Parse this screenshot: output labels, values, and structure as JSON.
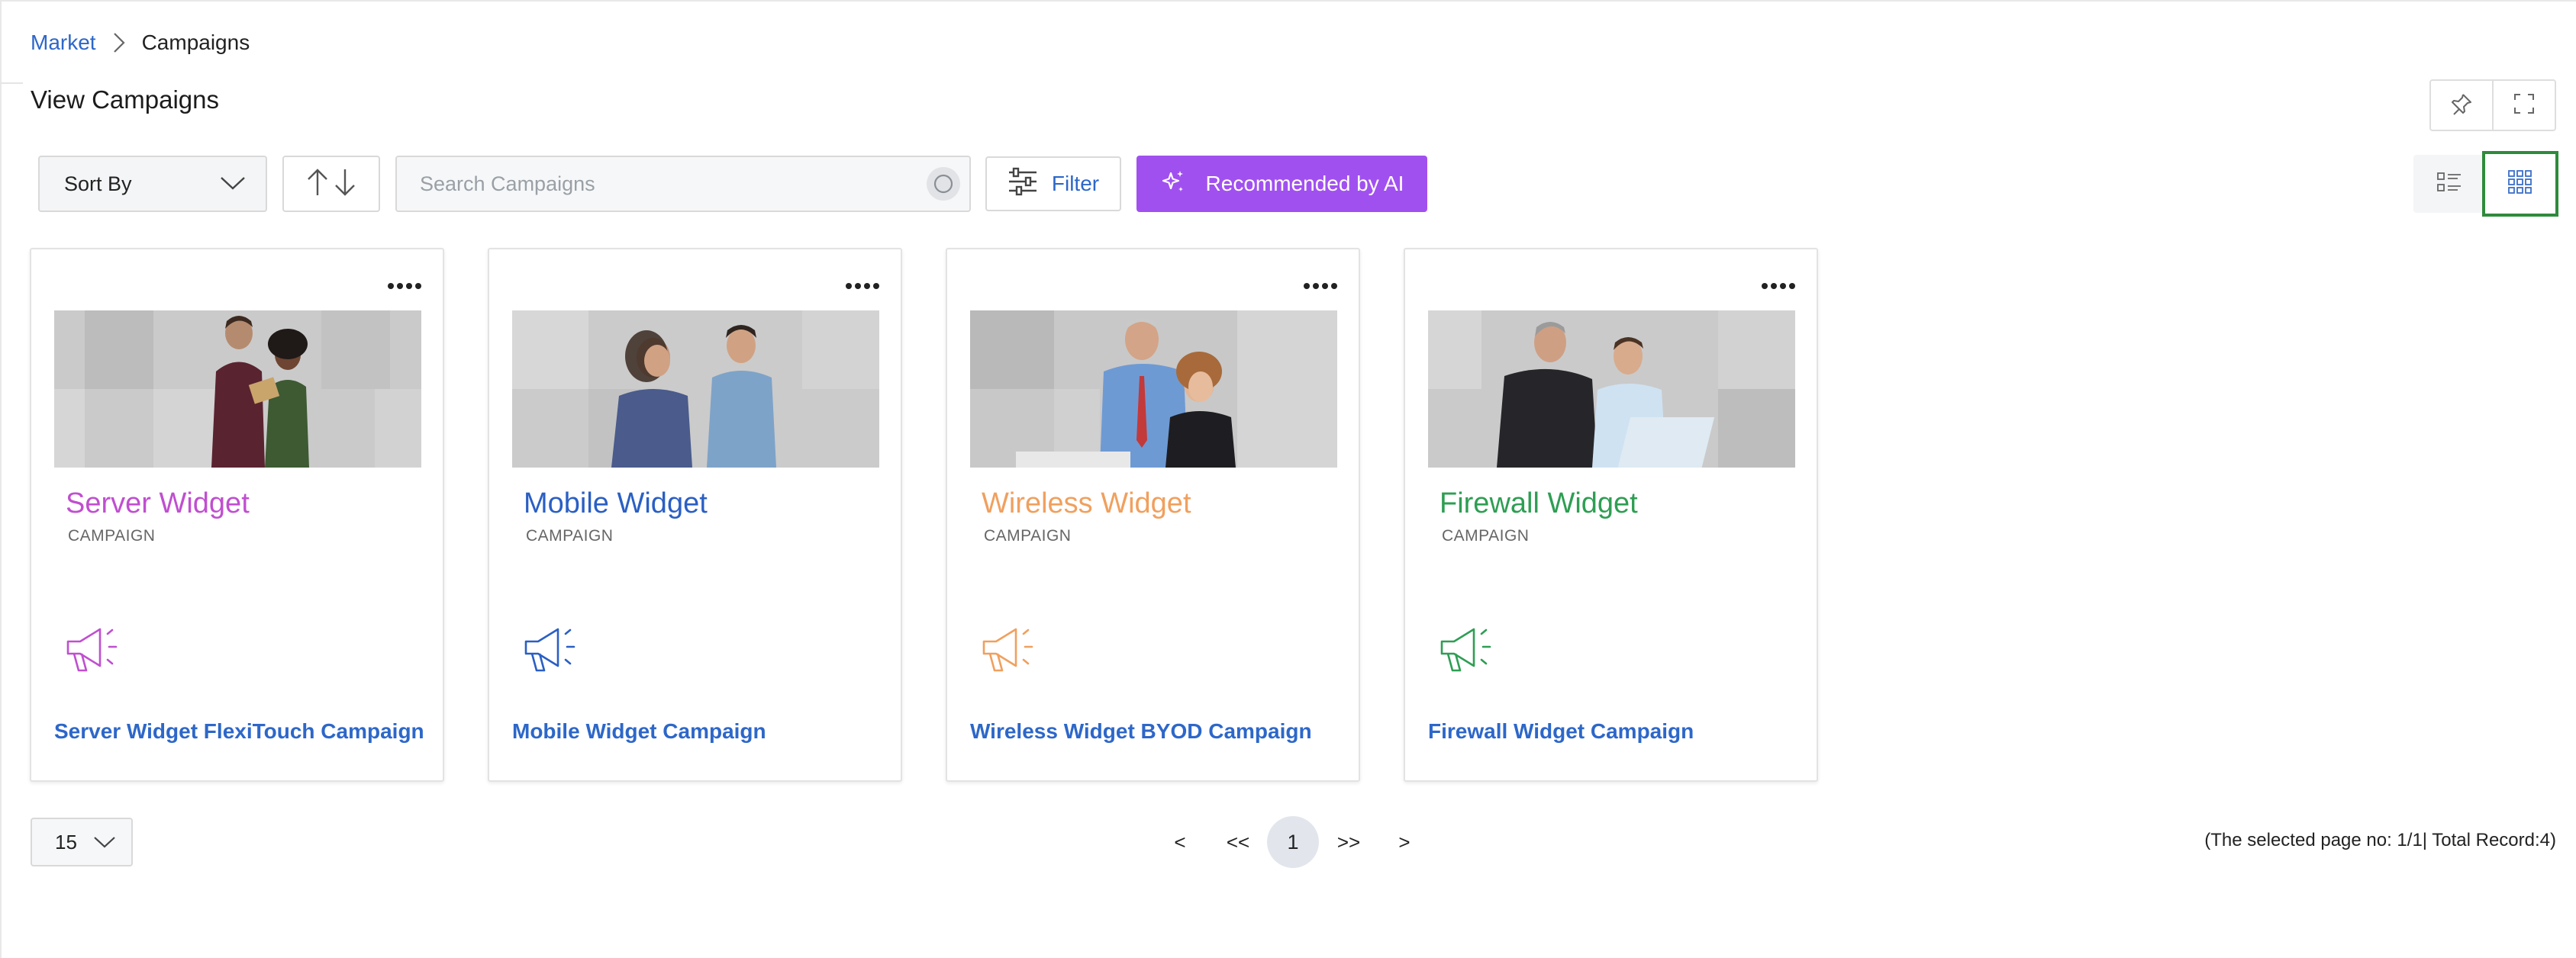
{
  "breadcrumb": {
    "parent": "Market",
    "current": "Campaigns"
  },
  "page": {
    "title": "View Campaigns"
  },
  "toolbar": {
    "sort_label": "Sort By",
    "search_placeholder": "Search Campaigns",
    "search_value": "",
    "filter_label": "Filter",
    "ai_label": "Recommended by AI"
  },
  "colors": {
    "link": "#2d67c9",
    "ai_button": "#a150f0",
    "active_view_border": "#2e8b3c"
  },
  "campaigns": [
    {
      "title": "Server Widget",
      "type": "CAMPAIGN",
      "link": "Server Widget FlexiTouch Campaign",
      "color": "#c04fd0",
      "icon": "megaphone-icon"
    },
    {
      "title": "Mobile Widget",
      "type": "CAMPAIGN",
      "link": "Mobile Widget Campaign",
      "color": "#2a5fc4",
      "icon": "megaphone-icon"
    },
    {
      "title": "Wireless Widget",
      "type": "CAMPAIGN",
      "link": "Wireless Widget BYOD Campaign",
      "color": "#f0a05e",
      "icon": "megaphone-icon"
    },
    {
      "title": "Firewall Widget",
      "type": "CAMPAIGN",
      "link": "Firewall Widget Campaign",
      "color": "#2e9e53",
      "icon": "megaphone-icon"
    }
  ],
  "pagination": {
    "page_size": "15",
    "prev": "<",
    "first": "<<",
    "current_page": "1",
    "last": ">>",
    "next": ">",
    "info": "(The selected page no: 1/1| Total Record:4)"
  }
}
